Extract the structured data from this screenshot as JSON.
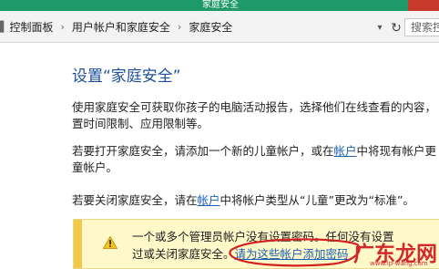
{
  "window": {
    "title": "家庭安全"
  },
  "address_bar": {
    "breadcrumbs": [
      {
        "label": "控制面板"
      },
      {
        "label": "用户帐户和家庭安全"
      },
      {
        "label": "家庭安全"
      }
    ],
    "search_placeholder": "搜索控"
  },
  "main": {
    "heading": "设置“家庭安全”",
    "para1": {
      "line1": "使用家庭安全可获取你孩子的电脑活动报告，选择他们在线查看的内容，",
      "line2": "置时间限制、应用限制等。"
    },
    "para2": {
      "line1_before": "若要打开家庭安全，请添加一个新的儿童帐户，或在",
      "line1_link": "帐户",
      "line1_after": "中将现有帐户更",
      "line2": "童帐户。"
    },
    "para3": {
      "before": "若要关闭家庭安全，请在",
      "link": "帐户",
      "after": "中将帐户类型从“儿童”更改为“标准”。"
    },
    "notice": {
      "line1": "一个或多个管理员帐户没有设置密码。任何没有设置",
      "line2_text": "过或关闭家庭安全。",
      "line2_link": "请为这些帐户添加密码"
    }
  },
  "watermark": {
    "brand": "广东龙网",
    "sub": "www.lp-wang.com"
  },
  "colors": {
    "titlebar": "#1e9a6a",
    "heading": "#1b4f9c",
    "link": "#1a5fb4",
    "notice_bg": "#fff8c9",
    "notice_strip": "#f0c94a",
    "annotation": "#d42020"
  }
}
